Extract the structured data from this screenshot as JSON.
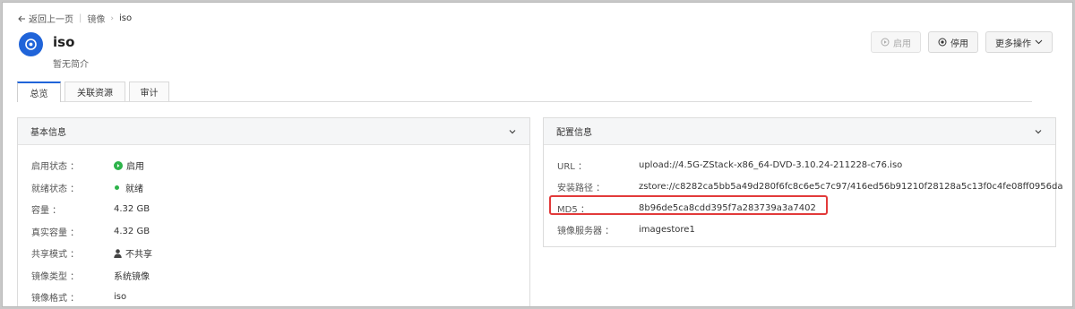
{
  "breadcrumb": {
    "back_label": "返回上一页",
    "parent": "镜像",
    "current": "iso"
  },
  "header": {
    "title": "iso",
    "description": "暂无简介"
  },
  "actions": {
    "enable_label": "启用",
    "disable_label": "停用",
    "more_label": "更多操作"
  },
  "tabs": [
    {
      "label": "总览"
    },
    {
      "label": "关联资源"
    },
    {
      "label": "审计"
    }
  ],
  "basic_info": {
    "title": "基本信息",
    "rows": [
      {
        "label": "启用状态 ：",
        "value": "启用"
      },
      {
        "label": "就绪状态 ：",
        "value": "就绪"
      },
      {
        "label": "容量 ：",
        "value": "4.32 GB"
      },
      {
        "label": "真实容量 ：",
        "value": "4.32 GB"
      },
      {
        "label": "共享模式 ：",
        "value": "不共享"
      },
      {
        "label": "镜像类型 ：",
        "value": "系统镜像"
      },
      {
        "label": "镜像格式 ：",
        "value": "iso"
      }
    ]
  },
  "config_info": {
    "title": "配置信息",
    "rows": [
      {
        "label": "URL ：",
        "value": "upload://4.5G-ZStack-x86_64-DVD-3.10.24-211228-c76.iso"
      },
      {
        "label": "安装路径 ：",
        "value": "zstore://c8282ca5bb5a49d280f6fc8c6e5c7c97/416ed56b91210f28128a5c13f0c4fe08ff0956da"
      },
      {
        "label": "MD5 ：",
        "value": "8b96de5ca8cdd395f7a283739a3a7402"
      },
      {
        "label": "镜像服务器 ：",
        "value": "imagestore1"
      }
    ]
  },
  "colors": {
    "accent": "#2064d9",
    "success": "#2db34a",
    "highlight": "#e23a3a"
  }
}
